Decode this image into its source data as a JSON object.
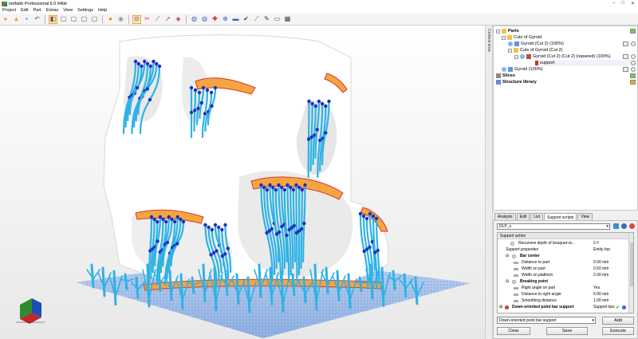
{
  "window": {
    "title": "netfabb Professional 6.0 64bit"
  },
  "menu": [
    "Project",
    "Edit",
    "Part",
    "Extras",
    "View",
    "Settings",
    "Help"
  ],
  "side_strip": {
    "label": "Context area"
  },
  "tree": {
    "parts": "Parts",
    "cuts_of_gyroid": "Cuts of Gyroid",
    "gyroid_cut2_100": "Gyroid (Cut 2) (100%)",
    "cuts_of_gyroid_cut2": "Cuts of Gyroid (Cut 2)",
    "gyroid_repaired": "Gyroid (Cut 2) (Cut 2) (repaired) (100%)",
    "support": "support",
    "gyroid_100": "Gyroid (100%)",
    "slices": "Slices",
    "structure_library": "Structure library"
  },
  "tabs": [
    "Analysis",
    "Edit",
    "List",
    "Support scripts",
    "View"
  ],
  "active_tab": "Support scripts",
  "script_select": "DLP_s",
  "grid": {
    "header": "Support action",
    "rows": [
      {
        "label": "Recursive depth of bouquet-st...",
        "value": "2 #"
      },
      {
        "label": "Support properties",
        "value": "Entity bar"
      },
      {
        "label": "Bar center",
        "value": ""
      },
      {
        "label": "Distance to part",
        "value": "0.00 mm"
      },
      {
        "label": "Width on part",
        "value": "0.50 mm"
      },
      {
        "label": "Width on platform",
        "value": "2.00 mm"
      },
      {
        "label": "Breaking point",
        "value": ""
      },
      {
        "label": "Right angle on part",
        "value": "Yes"
      },
      {
        "label": "Distance to right angle",
        "value": "6.00 mm"
      },
      {
        "label": "Smoothing distance",
        "value": "1.00 mm"
      },
      {
        "label": "Down-oriented point bar support",
        "value": "Support tips"
      }
    ]
  },
  "selected_action": "Down-oriented point bar support",
  "buttons": {
    "add": "Add",
    "clear": "Clear",
    "save": "Save",
    "execute": "Execute"
  },
  "colors": {
    "support": "#2eb2e6",
    "contact": "#1d2fbf",
    "part": "#ffffff",
    "platform": "#8fb6ea",
    "accent": "#f3a640"
  }
}
